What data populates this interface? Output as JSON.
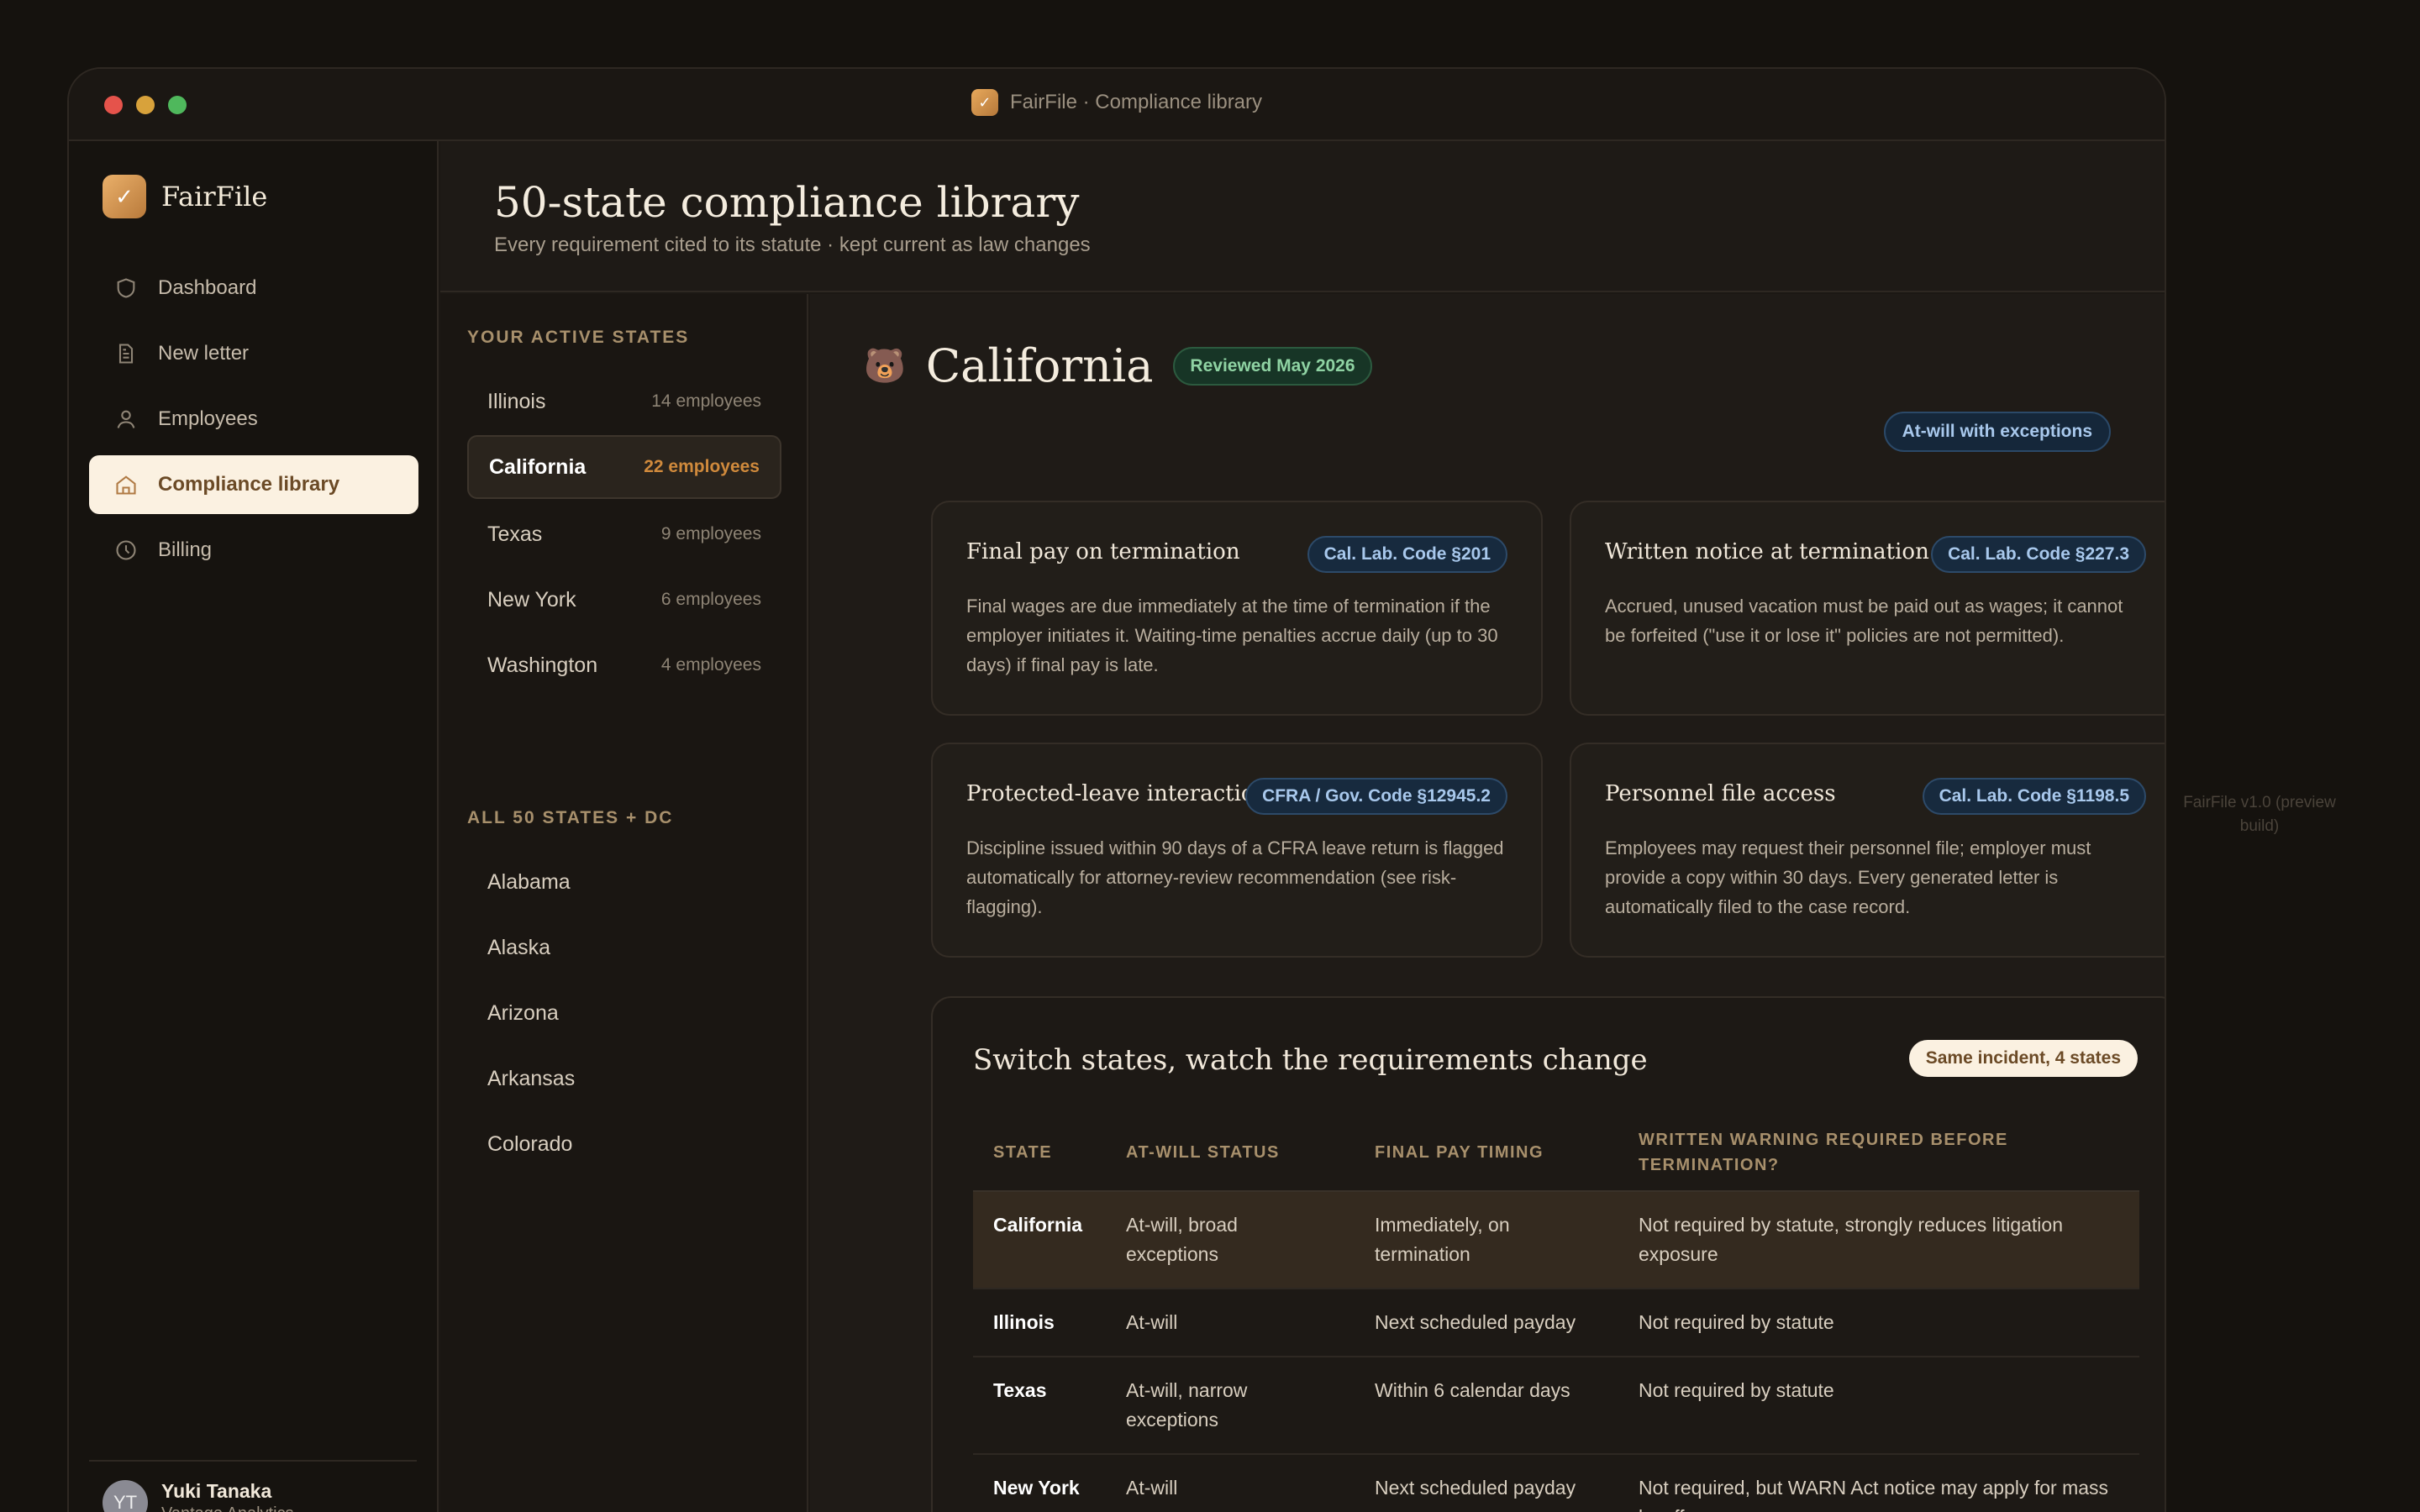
{
  "window": {
    "title": "FairFile · Compliance library"
  },
  "brand": {
    "name": "FairFile"
  },
  "nav": [
    {
      "label": "Dashboard",
      "icon": "shield-icon"
    },
    {
      "label": "New letter",
      "icon": "document-icon"
    },
    {
      "label": "Employees",
      "icon": "person-icon"
    },
    {
      "label": "Compliance library",
      "icon": "home-icon",
      "active": true
    },
    {
      "label": "Billing",
      "icon": "clock-icon"
    }
  ],
  "user": {
    "initials": "YT",
    "name": "Yuki Tanaka",
    "org": "Vantage Analytics"
  },
  "header": {
    "title": "50-state compliance library",
    "subtitle": "Every requirement cited to its statute · kept current as law changes"
  },
  "states": {
    "active_label": "YOUR ACTIVE STATES",
    "active": [
      {
        "name": "Illinois",
        "count": "14 employees"
      },
      {
        "name": "California",
        "count": "22 employees"
      },
      {
        "name": "Texas",
        "count": "9 employees"
      },
      {
        "name": "New York",
        "count": "6 employees"
      },
      {
        "name": "Washington",
        "count": "4 employees"
      }
    ],
    "all_label": "ALL 50 STATES + DC",
    "all": [
      "Alabama",
      "Alaska",
      "Arizona",
      "Arkansas",
      "Colorado"
    ]
  },
  "detail": {
    "state": "California",
    "icon": "bear-icon",
    "reviewed": "Reviewed May 2026",
    "status": "At-will with exceptions",
    "cards": [
      {
        "title": "Final pay on termination",
        "cite": "Cal. Lab. Code §201",
        "body": "Final wages are due immediately at the time of termination if the employer initiates it. Waiting-time penalties accrue daily (up to 30 days) if final pay is late."
      },
      {
        "title": "Written notice at termination",
        "cite": "Cal. Lab. Code §227.3",
        "body": "Accrued, unused vacation must be paid out as wages; it cannot be forfeited (\"use it or lose it\" policies are not permitted)."
      },
      {
        "title": "Protected-leave interaction",
        "cite": "CFRA / Gov. Code §12945.2",
        "body": "Discipline issued within 90 days of a CFRA leave return is flagged automatically for attorney-review recommendation (see risk-flagging)."
      },
      {
        "title": "Personnel file access",
        "cite": "Cal. Lab. Code §1198.5",
        "body": "Employees may request their personnel file; employer must provide a copy within 30 days. Every generated letter is automatically filed to the case record."
      }
    ]
  },
  "compare": {
    "title": "Switch states, watch the requirements change",
    "badge": "Same incident, 4 states",
    "headers": [
      "STATE",
      "AT-WILL STATUS",
      "FINAL PAY TIMING",
      "WRITTEN WARNING REQUIRED BEFORE TERMINATION?"
    ],
    "rows": [
      {
        "state": "California",
        "status": "At-will, broad exceptions",
        "pay": "Immediately, on termination",
        "warning": "Not required by statute, strongly reduces litigation exposure"
      },
      {
        "state": "Illinois",
        "status": "At-will",
        "pay": "Next scheduled payday",
        "warning": "Not required by statute"
      },
      {
        "state": "Texas",
        "status": "At-will, narrow exceptions",
        "pay": "Within 6 calendar days",
        "warning": "Not required by statute"
      },
      {
        "state": "New York",
        "status": "At-will",
        "pay": "Next scheduled payday",
        "warning": "Not required, but WARN Act notice may apply for mass layoffs"
      }
    ]
  },
  "footnote": "FairFile v1.0 (preview build)"
}
